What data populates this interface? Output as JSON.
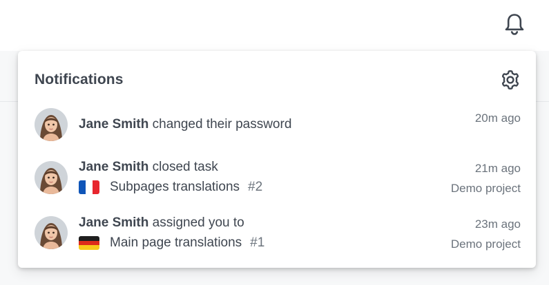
{
  "header": {
    "bell_icon": "bell-icon"
  },
  "panel": {
    "title": "Notifications",
    "settings_icon": "gear-icon"
  },
  "notifications": [
    {
      "actor": "Jane Smith",
      "action": " changed their password",
      "time": "20m ago"
    },
    {
      "actor": "Jane Smith",
      "action": " closed task",
      "flag": "fr",
      "task_name": "Subpages translations",
      "task_number": "#2",
      "time": "21m ago",
      "project": "Demo project"
    },
    {
      "actor": "Jane Smith",
      "action": " assigned you to",
      "flag": "de",
      "task_name": "Main page translations",
      "task_number": "#1",
      "time": "23m ago",
      "project": "Demo project"
    }
  ],
  "colors": {
    "text": "#3f4650",
    "muted": "#6b737c",
    "flag_fr_blue": "#0f55b8",
    "flag_fr_white": "#ffffff",
    "flag_fr_red": "#e7262e",
    "flag_de_black": "#1f1f1f",
    "flag_de_red": "#dd2a1b",
    "flag_de_gold": "#f8c91b"
  }
}
